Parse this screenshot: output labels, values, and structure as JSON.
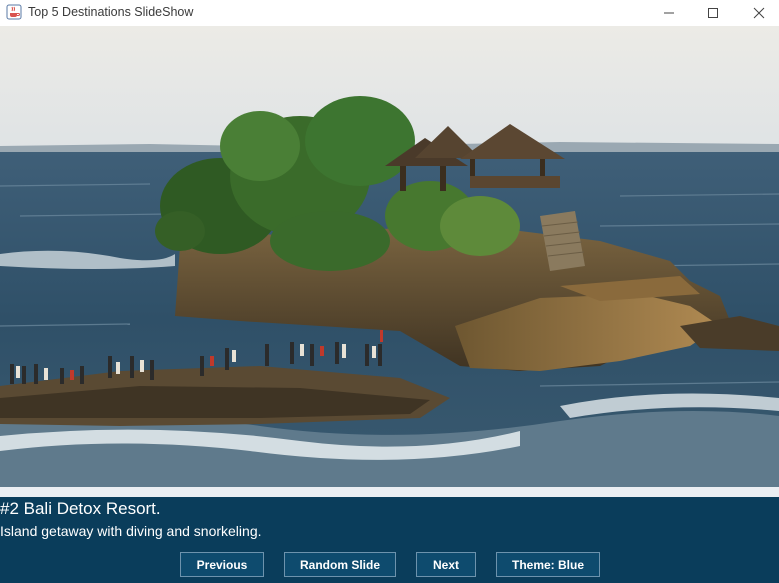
{
  "window": {
    "title": "Top 5 Destinations SlideShow",
    "icon": "java-cup-icon"
  },
  "slide": {
    "image_description_icon": "photo",
    "headline": "#2 Bali Detox Resort.",
    "description": "Island getaway with diving and snorkeling."
  },
  "buttons": {
    "previous": "Previous",
    "random": "Random Slide",
    "next": "Next",
    "theme": "Theme: Blue"
  },
  "colors": {
    "panel_bg": "#0a3d5b",
    "button_bg": "#0e4b6e",
    "button_border": "#6d93ad",
    "text": "#ffffff"
  }
}
